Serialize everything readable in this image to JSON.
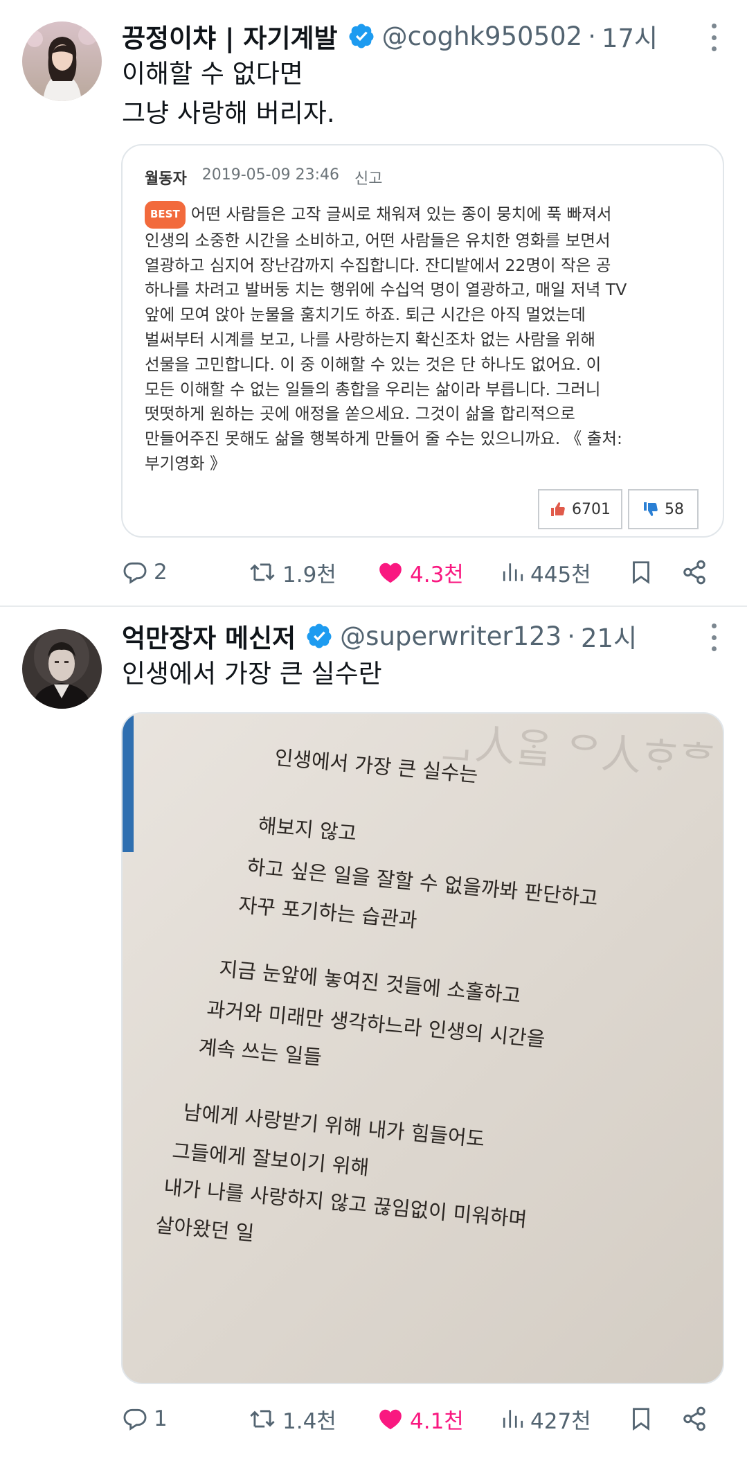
{
  "tweets": [
    {
      "author": {
        "name": "끙정이챠 | 자기계발",
        "handle": "@coghk950502",
        "separator": "·",
        "time": "17시"
      },
      "text_lines": [
        "이해할 수 없다면",
        "그냥 사랑해 버리자."
      ],
      "comment_card": {
        "user": "월동자",
        "datetime": "2019-05-09 23:46",
        "report": "신고",
        "badge": "BEST",
        "body_lines": [
          "어떤 사람들은 고작 글씨로 채워져 있는 종이 뭉치에 푹 빠져서",
          "인생의 소중한 시간을 소비하고, 어떤 사람들은 유치한 영화를 보면서",
          "열광하고 심지어 장난감까지 수집합니다. 잔디밭에서 22명이 작은 공",
          "하나를 차려고 발버둥 치는 행위에 수십억 명이 열광하고, 매일 저녁 TV",
          "앞에 모여 앉아 눈물을 훔치기도 하죠. 퇴근 시간은 아직 멀었는데",
          "벌써부터 시계를 보고, 나를 사랑하는지 확신조차 없는 사람을 위해",
          "선물을 고민합니다. 이 중 이해할 수 있는 것은 단 하나도 없어요. 이",
          "모든 이해할 수 없는 일들의 총합을 우리는 삶이라 부릅니다. 그러니",
          "떳떳하게 원하는 곳에 애정을 쏟으세요. 그것이 삶을 합리적으로",
          "만들어주진 못해도 삶을 행복하게 만들어 줄 수는 있으니까요. 《 출처:",
          "부기영화 》"
        ],
        "upvotes": "6701",
        "downvotes": "58"
      },
      "actions": {
        "replies": "2",
        "retweets": "1.9천",
        "likes": "4.3천",
        "views": "445천"
      }
    },
    {
      "author": {
        "name": "억만장자 메신저",
        "handle": "@superwriter123",
        "separator": "·",
        "time": "21시"
      },
      "text_lines": [
        "인생에서 가장 큰 실수란"
      ],
      "book_page": {
        "bleed_through": "ᄒᅠᄒᆞ人ᄋ ᄋᆞᆯ人ᆫ",
        "lines": [
          "인생에서 가장 큰 실수는",
          "해보지 않고",
          "하고 싶은 일을 잘할 수 없을까봐 판단하고",
          "자꾸 포기하는 습관과",
          "지금 눈앞에 놓여진 것들에 소홀하고",
          "과거와 미래만 생각하느라 인생의 시간을",
          "계속 쓰는 일들",
          "남에게 사랑받기 위해 내가 힘들어도",
          "그들에게 잘보이기 위해",
          "내가 나를 사랑하지 않고 끊임없이 미워하며",
          "살아왔던 일"
        ]
      },
      "actions": {
        "replies": "1",
        "retweets": "1.4천",
        "likes": "4.1천",
        "views": "427천"
      }
    }
  ],
  "icons": {
    "verified": "verified-badge-icon",
    "more": "more-options-icon",
    "reply": "reply-icon",
    "retweet": "retweet-icon",
    "like": "heart-icon",
    "views": "views-icon",
    "bookmark": "bookmark-icon",
    "share": "share-icon"
  },
  "colors": {
    "verified_blue": "#1d9bf0",
    "like_pink": "#f91880",
    "meta_gray": "#536471",
    "best_orange": "#f26a3c"
  }
}
